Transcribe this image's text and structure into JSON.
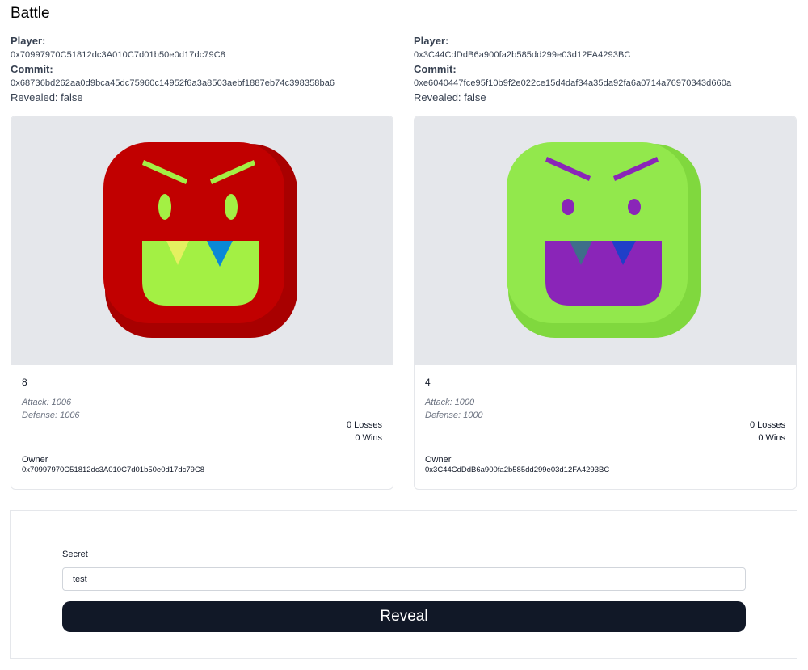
{
  "page": {
    "title": "Battle"
  },
  "players": [
    {
      "player_label": "Player:",
      "player_address": "0x70997970C51812dc3A010C7d01b50e0d17dc79C8",
      "commit_label": "Commit:",
      "commit_hash": "0x68736bd262aa0d9bca45dc75960c14952f6a3a8503aebf1887eb74c398358ba6",
      "revealed_text": "Revealed: false",
      "card": {
        "id": "8",
        "attack": "Attack: 1006",
        "defense": "Defense: 1006",
        "losses": "0 Losses",
        "wins": "0 Wins",
        "owner_label": "Owner",
        "owner_address": "0x70997970C51812dc3A010C7d01b50e0d17dc79C8",
        "colors": {
          "face": "#c10000",
          "face_shade": "#a80000",
          "features": "#a3f044",
          "tooth_left": "#e4f060",
          "tooth_right": "#0a88d6"
        }
      }
    },
    {
      "player_label": "Player:",
      "player_address": "0x3C44CdDdB6a900fa2b585dd299e03d12FA4293BC",
      "commit_label": "Commit:",
      "commit_hash": "0xe6040447fce95f10b9f2e022ce15d4daf34a35da92fa6a0714a76970343d660a",
      "revealed_text": "Revealed: false",
      "card": {
        "id": "4",
        "attack": "Attack: 1000",
        "defense": "Defense: 1000",
        "losses": "0 Losses",
        "wins": "0 Wins",
        "owner_label": "Owner",
        "owner_address": "0x3C44CdDdB6a900fa2b585dd299e03d12FA4293BC",
        "colors": {
          "face": "#92e84c",
          "face_shade": "#80d83e",
          "features": "#8a25b8",
          "tooth_left": "#3e6e8a",
          "tooth_right": "#1f3fc8"
        }
      }
    }
  ],
  "reveal_form": {
    "secret_label": "Secret",
    "secret_value": "test",
    "reveal_label": "Reveal"
  }
}
